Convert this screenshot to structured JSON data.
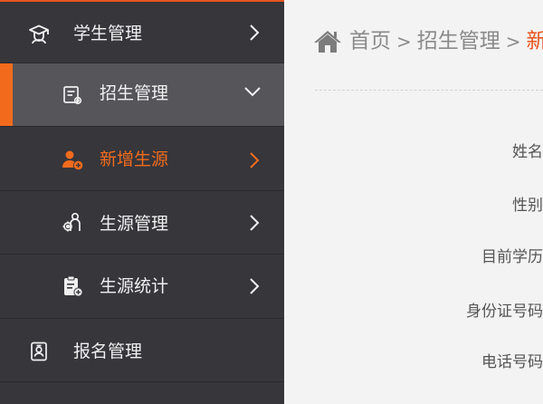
{
  "colors": {
    "sidebar_bg": "#36363b",
    "sidebar_open_bg": "#55555a",
    "accent": "#f26b1d",
    "content_bg": "#f3f3f3"
  },
  "sidebar": {
    "items": [
      {
        "label": "学生管理",
        "icon": "graduate-icon",
        "level": 1,
        "state": "collapsed"
      },
      {
        "label": "招生管理",
        "icon": "enrollment-gear-icon",
        "level": 2,
        "state": "expanded"
      },
      {
        "label": "新增生源",
        "icon": "add-user-icon",
        "level": 2,
        "state": "active"
      },
      {
        "label": "生源管理",
        "icon": "user-gear-icon",
        "level": 2,
        "state": "collapsed"
      },
      {
        "label": "生源统计",
        "icon": "clipboard-stats-icon",
        "level": 2,
        "state": "collapsed"
      },
      {
        "label": "报名管理",
        "icon": "id-card-icon",
        "level": 1,
        "state": "collapsed"
      }
    ]
  },
  "breadcrumb": {
    "home_icon": "home-icon",
    "items": [
      "首页",
      "招生管理",
      "新"
    ]
  },
  "form": {
    "labels": [
      "姓名",
      "性别",
      "目前学历",
      "身份证号码",
      "电话号码"
    ]
  }
}
